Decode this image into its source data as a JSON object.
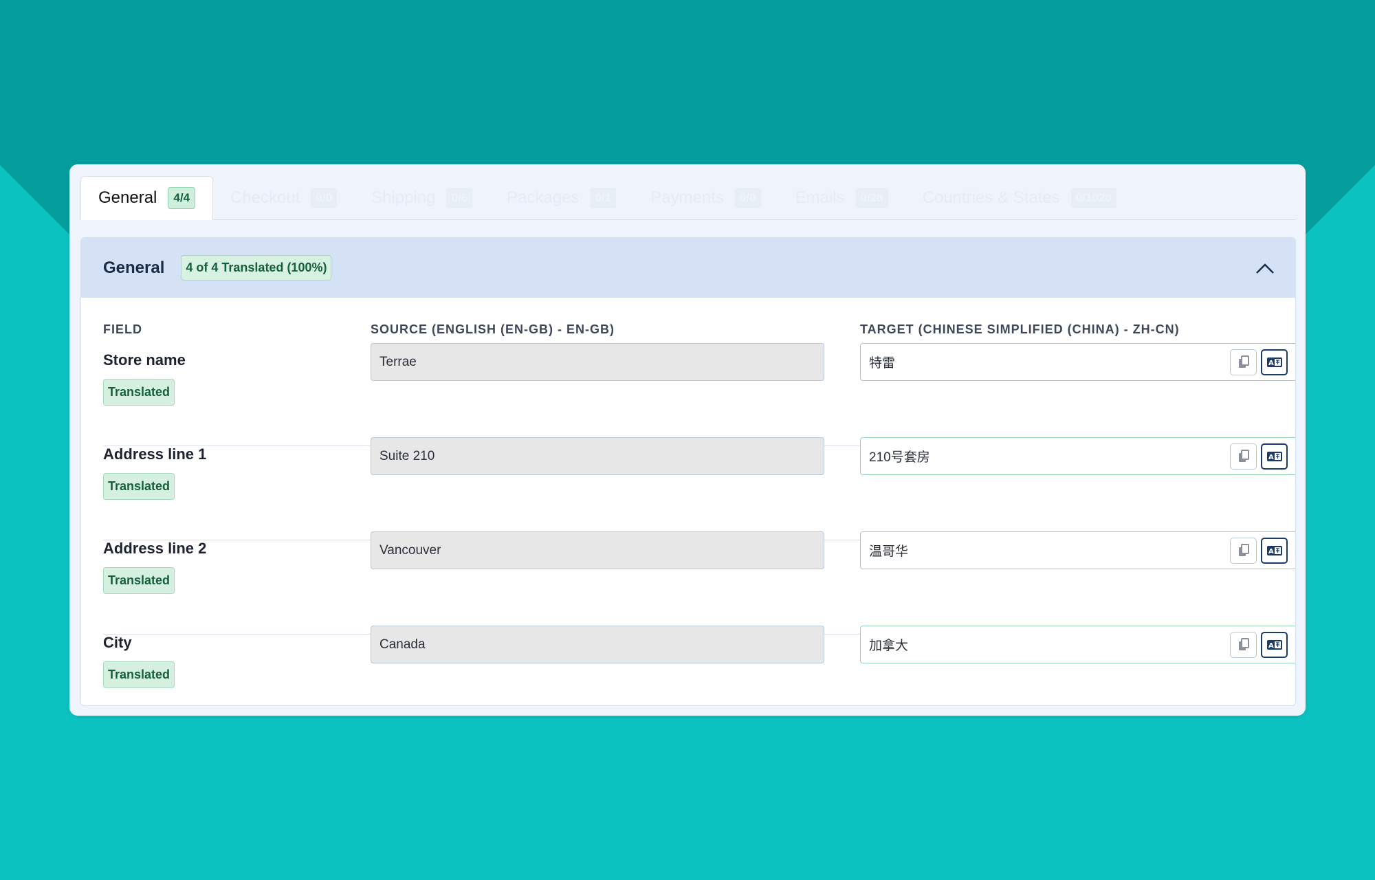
{
  "tabs": [
    {
      "label": "General",
      "count": "4/4",
      "active": true
    },
    {
      "label": "Checkout",
      "count": "0/0",
      "active": false
    },
    {
      "label": "Shipping",
      "count": "0/6",
      "active": false
    },
    {
      "label": "Packages",
      "count": "0/1",
      "active": false
    },
    {
      "label": "Payments",
      "count": "0/0",
      "active": false
    },
    {
      "label": "Emails",
      "count": "0/28",
      "active": false
    },
    {
      "label": "Countries & States",
      "count": "0/1020",
      "active": false
    }
  ],
  "panel": {
    "title": "General",
    "progress": "4 of 4 Translated (100%)",
    "collapse_icon": "chevron-up-icon"
  },
  "columns": {
    "field": "FIELD",
    "source": "SOURCE (ENGLISH (EN-GB) - EN-GB)",
    "target": "TARGET (CHINESE SIMPLIFIED (CHINA) - ZH-CN)"
  },
  "rows": [
    {
      "field": "Store name",
      "status": "Translated",
      "source": "Terrae",
      "target": "特雷"
    },
    {
      "field": "Address line 1",
      "status": "Translated",
      "source": "Suite 210",
      "target": "210号套房"
    },
    {
      "field": "Address line 2",
      "status": "Translated",
      "source": "Vancouver",
      "target": "温哥华"
    },
    {
      "field": "City",
      "status": "Translated",
      "source": "Canada",
      "target": "加拿大"
    }
  ],
  "row_actions": {
    "copy_icon": "copy-icon",
    "translate_icon": "translate-icon"
  },
  "colors": {
    "background": "#0cc2c1",
    "background_top": "#039e9c",
    "panel_header": "#d5e2f5",
    "success_badge": "#d5f0e1",
    "success_text": "#155f3a"
  }
}
